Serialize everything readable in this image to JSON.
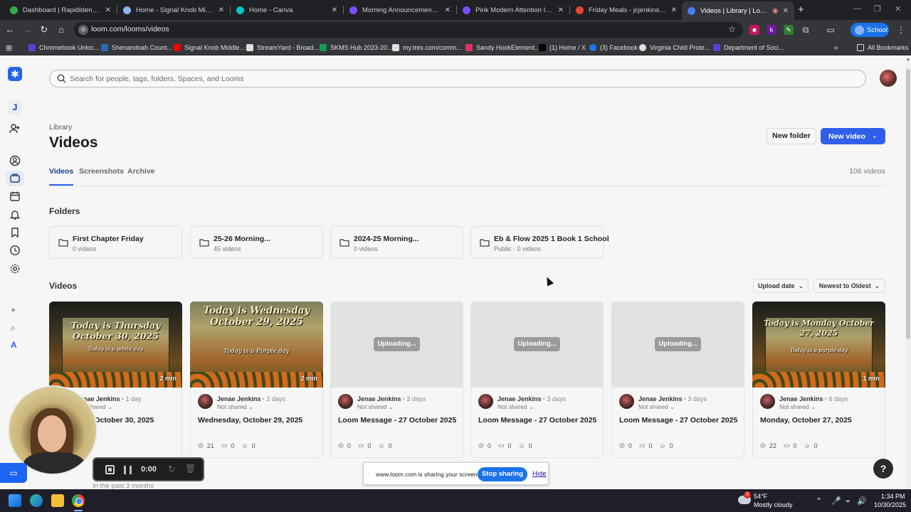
{
  "browser": {
    "tabs": [
      {
        "label": "Dashboard | RapidIdentity",
        "color": "#34a853"
      },
      {
        "label": "Home - Signal Knob Middle",
        "color": "#8ab4f8"
      },
      {
        "label": "Home - Canva",
        "color": "#00c4cc"
      },
      {
        "label": "Morning Announcement Slides",
        "color": "#7c4dff"
      },
      {
        "label": "Pink Modern Attention Importa",
        "color": "#7c4dff"
      },
      {
        "label": "Friday Meals - jcjenkins@shena",
        "color": "#ea4335"
      },
      {
        "label": "Videos | Library | Loom",
        "color": "#4a7cf7"
      }
    ],
    "close_glyph": "✕",
    "new_tab_glyph": "+",
    "url": "loom.com/looms/videos",
    "profile_label": "School",
    "bookmarks": [
      {
        "label": "Chromebook Unloc...",
        "color": "#5b3fd6"
      },
      {
        "label": "Shenandoah Count...",
        "color": "#2b6cb0"
      },
      {
        "label": "Signal Knob Middle...",
        "color": "#ff0000"
      },
      {
        "label": "StreamYard - Broad...",
        "color": "#e0e0e0"
      },
      {
        "label": "SKMS Hub 2023-20...",
        "color": "#0f9d58"
      },
      {
        "label": "my.trex.com/comm...",
        "color": "#e0e0e0"
      },
      {
        "label": "Sandy HookElement...",
        "color": "#e1306c"
      },
      {
        "label": "(1) Home / X",
        "color": "#000000"
      },
      {
        "label": "(3) Facebook",
        "color": "#1877f2"
      },
      {
        "label": "Virginia Child Prote...",
        "color": "#e0e0e0"
      },
      {
        "label": "Department of Soci...",
        "color": "#5b3fd6"
      }
    ],
    "all_bookmarks": "All Bookmarks"
  },
  "rail": {
    "workspace_initial": "J",
    "tool_glyphs": [
      "+",
      "⌕",
      "A"
    ]
  },
  "search": {
    "placeholder": "Search for people, tags, folders, Spaces, and Looms"
  },
  "header": {
    "breadcrumb": "Library",
    "title": "Videos",
    "new_folder": "New folder",
    "new_video": "New video",
    "chevron": "⌄"
  },
  "tabs": {
    "items": [
      "Videos",
      "Screenshots",
      "Archive"
    ],
    "count": "106 videos"
  },
  "folders": {
    "heading": "Folders",
    "items": [
      {
        "name": "First Chapter Friday",
        "meta": "0 videos"
      },
      {
        "name": "25-26 Morning...",
        "meta": "45 videos"
      },
      {
        "name": "2024-25 Morning...",
        "meta": "0 videos"
      },
      {
        "name": "Eb & Flow 2025 1 Book 1 School",
        "meta": "Public · 0 videos"
      }
    ]
  },
  "videos": {
    "heading": "Videos",
    "sort_field": "Upload date",
    "sort_order": "Newest to Oldest",
    "share_glyph": "⌄",
    "stat_glyphs": {
      "views": "◎",
      "comments": "▭",
      "reactions": "☺"
    },
    "items": [
      {
        "thumb_line1": "Today is Thursday",
        "thumb_line2": "October 30, 2025",
        "thumb_line3": "Today is a white day",
        "duration": "2 min",
        "author": "Jenae Jenkins",
        "age": "1 day",
        "sharing": "Not shared",
        "title": "Thursday, October 30, 2025",
        "views": "",
        "comments": "",
        "reactions": "1"
      },
      {
        "thumb_line1": "Today is Wednesday",
        "thumb_line2": "October 29, 2025",
        "thumb_line3": "Today is a Purple day",
        "duration": "2 min",
        "author": "Jenae Jenkins",
        "age": "2 days",
        "sharing": "Not shared",
        "title": "Wednesday, October 29, 2025",
        "views": "21",
        "comments": "0",
        "reactions": "0"
      },
      {
        "uploading": "Uploading...",
        "author": "Jenae Jenkins",
        "age": "3 days",
        "sharing": "Not shared",
        "title": "Loom Message - 27 October 2025",
        "views": "0",
        "comments": "0",
        "reactions": "0"
      },
      {
        "uploading": "Uploading...",
        "author": "Jenae Jenkins",
        "age": "3 days",
        "sharing": "Not shared",
        "title": "Loom Message - 27 October 2025",
        "views": "0",
        "comments": "0",
        "reactions": "0"
      },
      {
        "uploading": "Uploading...",
        "author": "Jenae Jenkins",
        "age": "3 days",
        "sharing": "Not shared",
        "title": "Loom Message - 27 October 2025",
        "views": "0",
        "comments": "0",
        "reactions": "0"
      },
      {
        "thumb_line1": "Today is Monday October",
        "thumb_line2": "27, 2025",
        "thumb_line3": "Today is a purple day",
        "duration": "1 min",
        "author": "Jenae Jenkins",
        "age": "6 days",
        "sharing": "Not shared",
        "title": "Monday, October 27, 2025",
        "views": "22",
        "comments": "0",
        "reactions": "0"
      }
    ]
  },
  "bottom_hint": "In the past 3 months",
  "recorder": {
    "time": "0:00"
  },
  "share_bar": {
    "message": "www.loom.com is sharing your screen.",
    "stop": "Stop sharing",
    "hide": "Hide"
  },
  "help": "?",
  "taskbar": {
    "weather_badge": "3",
    "temperature": "54°F",
    "weather": "Mostly cloudy",
    "time": "1:34 PM",
    "date": "10/30/2025"
  }
}
